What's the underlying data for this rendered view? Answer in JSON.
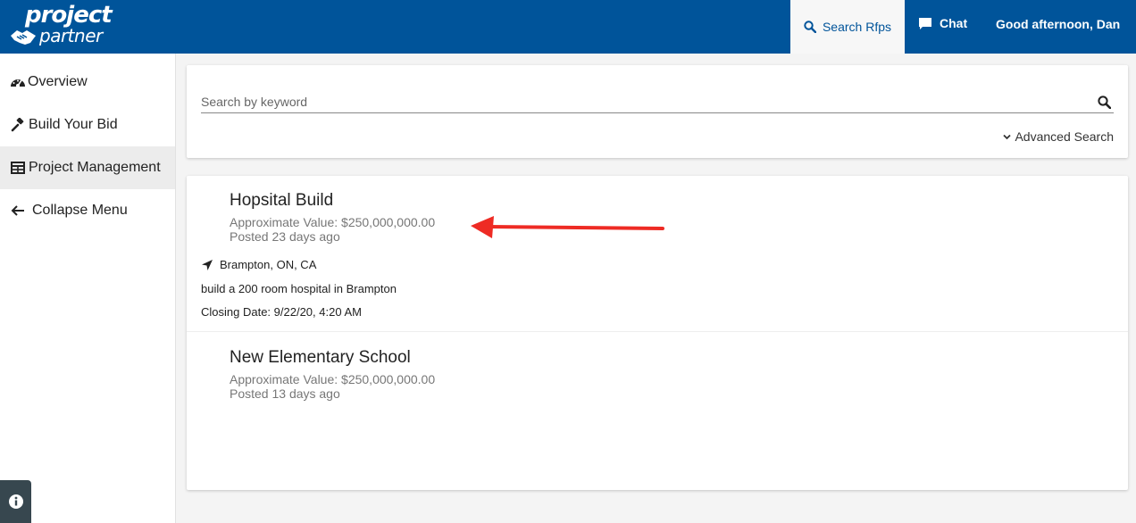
{
  "brand": {
    "line1": "project",
    "line2": "partner"
  },
  "topnav": {
    "search_rfps": "Search Rfps",
    "chat": "Chat",
    "greeting": "Good afternoon, Dan"
  },
  "sidebar": {
    "items": [
      {
        "label": "Overview",
        "icon": "dashboard-icon"
      },
      {
        "label": "Build Your Bid",
        "icon": "gavel-icon"
      },
      {
        "label": "Project Management",
        "icon": "table-icon",
        "active": true
      },
      {
        "label": "Collapse Menu",
        "icon": "arrow-left-icon"
      }
    ]
  },
  "search": {
    "placeholder": "Search by keyword",
    "advanced_label": "Advanced Search"
  },
  "results": [
    {
      "title": "Hopsital Build",
      "value": "Approximate Value: $250,000,000.00",
      "posted": "Posted 23 days ago",
      "location": "Brampton, ON, CA",
      "description": "build a 200 room hospital in Brampton",
      "closing": "Closing Date: 9/22/20, 4:20 AM"
    },
    {
      "title": "New Elementary School",
      "value": "Approximate Value: $250,000,000.00",
      "posted": "Posted 13 days ago"
    }
  ],
  "colors": {
    "primary": "#00549a",
    "annotation_arrow": "#ee2b24"
  }
}
